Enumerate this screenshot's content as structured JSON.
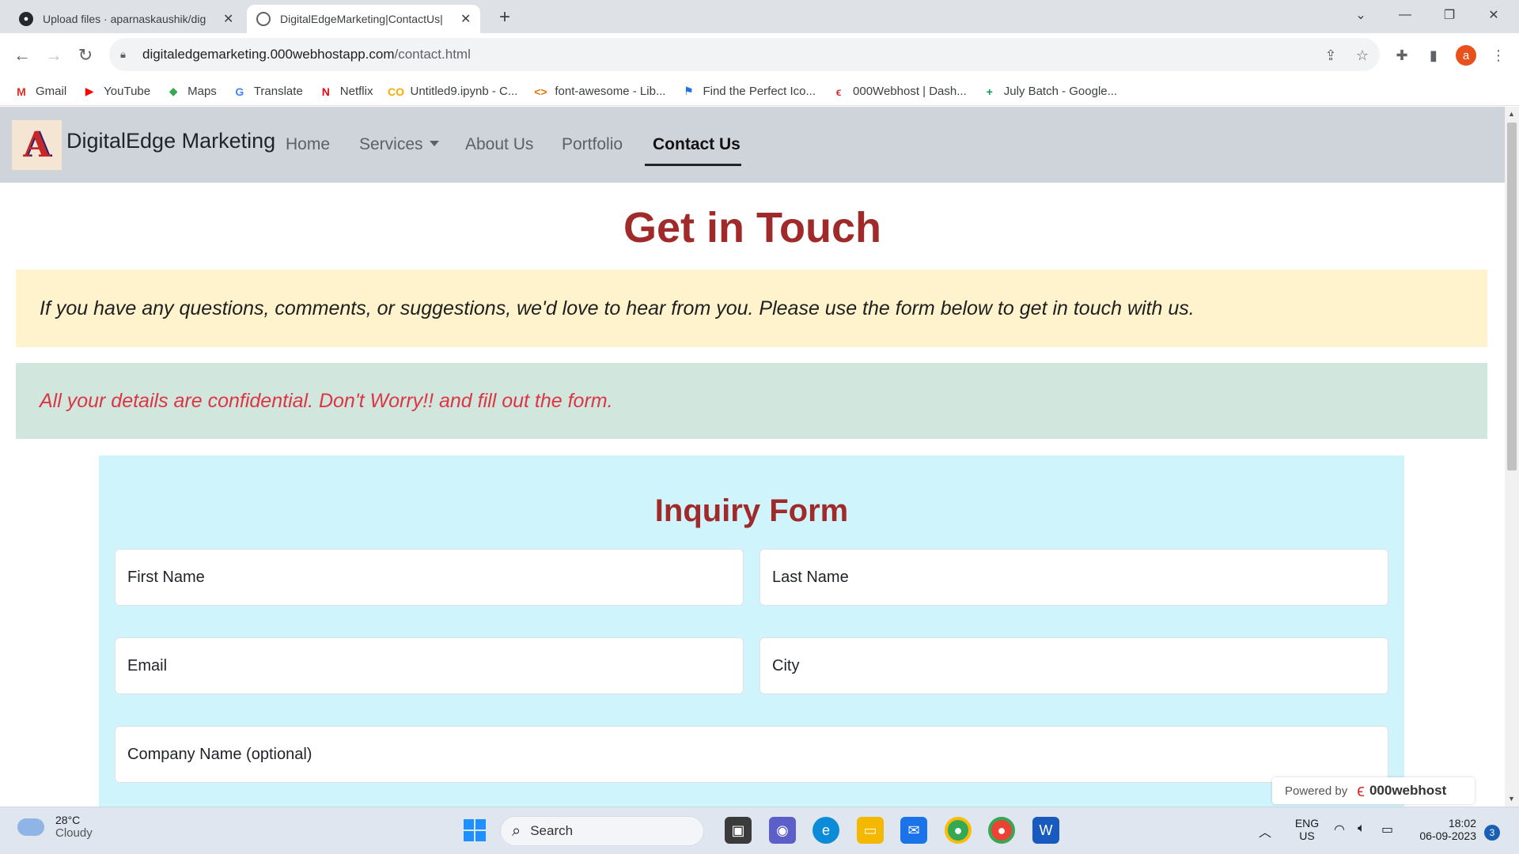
{
  "browser": {
    "tabs": [
      {
        "title": "Upload files · aparnaskaushik/dig",
        "close": "✕"
      },
      {
        "title": "DigitalEdgeMarketing|ContactUs|",
        "close": "✕"
      }
    ],
    "new_tab": "+",
    "window": {
      "dropdown": "⌄",
      "minimize": "—",
      "restore": "❐",
      "close": "✕"
    },
    "url_domain": "digitaledgemarketing.000webhostapp.com",
    "url_path": "/contact.html",
    "avatar_letter": "a",
    "bookmarks": [
      {
        "label": "Gmail",
        "icon": "gmail-icon",
        "glyph": "M",
        "color": "#d93025"
      },
      {
        "label": "YouTube",
        "icon": "youtube-icon",
        "glyph": "▶",
        "color": "#ff0000"
      },
      {
        "label": "Maps",
        "icon": "maps-icon",
        "glyph": "◆",
        "color": "#34a853"
      },
      {
        "label": "Translate",
        "icon": "translate-icon",
        "glyph": "G",
        "color": "#4285f4"
      },
      {
        "label": "Netflix",
        "icon": "netflix-icon",
        "glyph": "N",
        "color": "#e50914"
      },
      {
        "label": "Untitled9.ipynb - C...",
        "icon": "colab-icon",
        "glyph": "CO",
        "color": "#f9ab00"
      },
      {
        "label": "font-awesome - Lib...",
        "icon": "code-icon",
        "glyph": "<>",
        "color": "#e8710a"
      },
      {
        "label": "Find the Perfect Ico...",
        "icon": "flag-icon",
        "glyph": "⚑",
        "color": "#1a73e8"
      },
      {
        "label": "000Webhost | Dash...",
        "icon": "webhost-icon",
        "glyph": "ϵ",
        "color": "#d32f2f"
      },
      {
        "label": "July Batch - Google...",
        "icon": "sheets-icon",
        "glyph": "+",
        "color": "#0f9d58"
      }
    ]
  },
  "site": {
    "brand": "DigitalEdge Marketing",
    "logo_letter": "A",
    "nav": {
      "home": "Home",
      "services": "Services",
      "about": "About Us",
      "portfolio": "Portfolio",
      "contact": "Contact Us"
    },
    "heading": "Get in Touch",
    "intro": "If you have any questions, comments, or suggestions, we'd love to hear from you. Please use the form below to get in touch with us.",
    "notice": "All your details are confidential. Don't Worry!! and fill out the form.",
    "form": {
      "title": "Inquiry Form",
      "first_name": "First Name",
      "last_name": "Last Name",
      "email": "Email",
      "city": "City",
      "company": "Company Name (optional)"
    },
    "powered": {
      "label": "Powered by",
      "brand": "000webhost"
    }
  },
  "taskbar": {
    "weather_temp": "28°C",
    "weather_desc": "Cloudy",
    "search": "Search",
    "lang_top": "ENG",
    "lang_bottom": "US",
    "time": "18:02",
    "date": "06-09-2023",
    "notifications": "3"
  },
  "colors": {
    "accent_heading": "#a02a2a",
    "warning_bg": "#fff3cd",
    "success_bg": "#d1e7dd",
    "danger_text": "#dc3545",
    "info_bg": "#cff4fc",
    "navbar_bg": "#ced4da"
  }
}
